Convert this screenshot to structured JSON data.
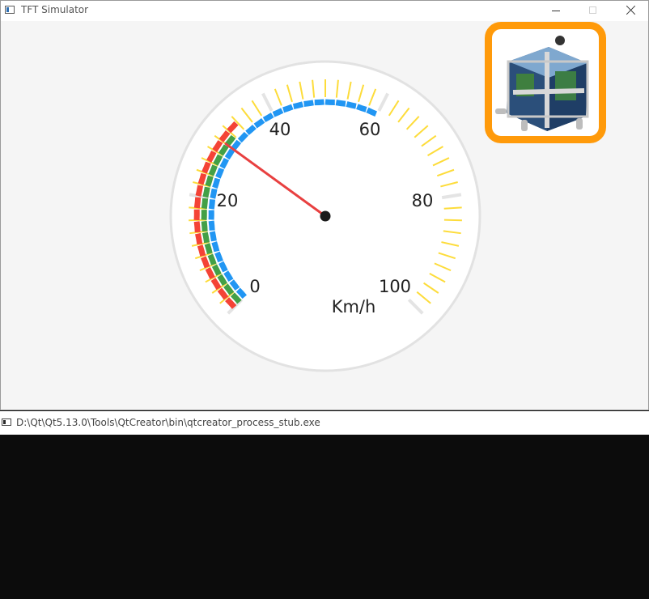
{
  "window": {
    "title": "TFT Simulator",
    "buttons": [
      "minimize",
      "maximize",
      "close"
    ]
  },
  "gauge": {
    "min": 0,
    "max": 100,
    "value": 30,
    "labels": [
      "0",
      "20",
      "40",
      "60",
      "80",
      "100"
    ],
    "unit": "Km/h",
    "colors": {
      "needle": "#e84040",
      "ring_blue": "#2196f3",
      "ring_green": "#43a047",
      "ring_red": "#f44336",
      "tick_yellow": "#fddc3a",
      "tick_gray": "#e4e4e4",
      "face": "#ffffff",
      "rim": "#e2e2e2"
    }
  },
  "logo": {
    "border_color": "#ff9a0a",
    "icon": "hardware-module-icon"
  },
  "console": {
    "title": "D:\\Qt\\Qt5.13.0\\Tools\\QtCreator\\bin\\qtcreator_process_stub.exe",
    "background": "#0c0c0c"
  }
}
